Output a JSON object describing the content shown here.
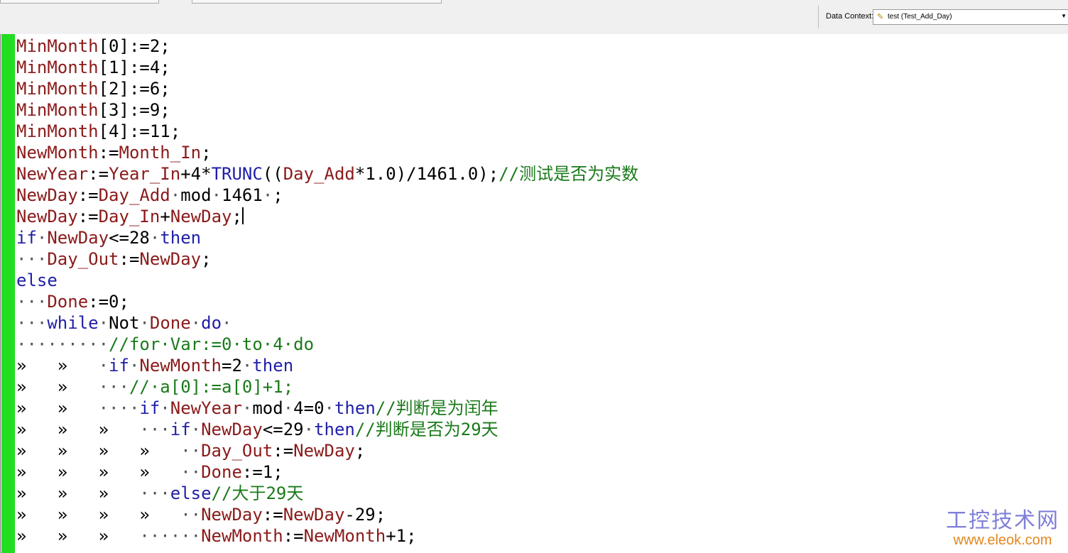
{
  "toolbar": {
    "data_context_label": "Data Context:",
    "data_context_value": "test (Test_Add_Day)",
    "data_context_icon": "pencil-icon"
  },
  "editor": {
    "gutter_color": "#22dd22",
    "lines": [
      [
        {
          "t": "MinMonth",
          "c": "id"
        },
        {
          "t": "[0]:=2;",
          "c": "op"
        }
      ],
      [
        {
          "t": "MinMonth",
          "c": "id"
        },
        {
          "t": "[1]:=4;",
          "c": "op"
        }
      ],
      [
        {
          "t": "MinMonth",
          "c": "id"
        },
        {
          "t": "[2]:=6;",
          "c": "op"
        }
      ],
      [
        {
          "t": "MinMonth",
          "c": "id"
        },
        {
          "t": "[3]:=9;",
          "c": "op"
        }
      ],
      [
        {
          "t": "MinMonth",
          "c": "id"
        },
        {
          "t": "[4]:=11;",
          "c": "op"
        }
      ],
      [
        {
          "t": "NewMonth",
          "c": "id"
        },
        {
          "t": ":=",
          "c": "op"
        },
        {
          "t": "Month_In",
          "c": "id"
        },
        {
          "t": ";",
          "c": "op"
        }
      ],
      [
        {
          "t": "NewYear",
          "c": "id"
        },
        {
          "t": ":=",
          "c": "op"
        },
        {
          "t": "Year_In",
          "c": "id"
        },
        {
          "t": "+4*",
          "c": "op"
        },
        {
          "t": "TRUNC",
          "c": "kw"
        },
        {
          "t": "((",
          "c": "op"
        },
        {
          "t": "Day_Add",
          "c": "id"
        },
        {
          "t": "*1.0)/1461.0);",
          "c": "op"
        },
        {
          "t": "//测试是否为实数",
          "c": "cm"
        }
      ],
      [
        {
          "t": "NewDay",
          "c": "id"
        },
        {
          "t": ":=",
          "c": "op"
        },
        {
          "t": "Day_Add",
          "c": "id"
        },
        {
          "t": "·",
          "c": "ws"
        },
        {
          "t": "mod",
          "c": "op"
        },
        {
          "t": "·",
          "c": "ws"
        },
        {
          "t": "1461",
          "c": "op"
        },
        {
          "t": "·",
          "c": "ws"
        },
        {
          "t": ";",
          "c": "op"
        }
      ],
      [
        {
          "t": "NewDay",
          "c": "id"
        },
        {
          "t": ":=",
          "c": "op"
        },
        {
          "t": "Day_In",
          "c": "id"
        },
        {
          "t": "+",
          "c": "op"
        },
        {
          "t": "NewDay",
          "c": "id"
        },
        {
          "t": ";",
          "c": "op"
        },
        {
          "t": "",
          "c": "cursor"
        }
      ],
      [
        {
          "t": "if",
          "c": "kw"
        },
        {
          "t": "·",
          "c": "ws"
        },
        {
          "t": "NewDay",
          "c": "id"
        },
        {
          "t": "<=28",
          "c": "op"
        },
        {
          "t": "·",
          "c": "ws"
        },
        {
          "t": "then",
          "c": "kw"
        }
      ],
      [
        {
          "t": "···",
          "c": "ws"
        },
        {
          "t": "Day_Out",
          "c": "id"
        },
        {
          "t": ":=",
          "c": "op"
        },
        {
          "t": "NewDay",
          "c": "id"
        },
        {
          "t": ";",
          "c": "op"
        }
      ],
      [
        {
          "t": "else",
          "c": "kw"
        }
      ],
      [
        {
          "t": "···",
          "c": "ws"
        },
        {
          "t": "Done",
          "c": "id"
        },
        {
          "t": ":=0;",
          "c": "op"
        }
      ],
      [
        {
          "t": "···",
          "c": "ws"
        },
        {
          "t": "while",
          "c": "kw"
        },
        {
          "t": "·",
          "c": "ws"
        },
        {
          "t": "Not",
          "c": "op"
        },
        {
          "t": "·",
          "c": "ws"
        },
        {
          "t": "Done",
          "c": "id"
        },
        {
          "t": "·",
          "c": "ws"
        },
        {
          "t": "do",
          "c": "kw"
        },
        {
          "t": "·",
          "c": "ws"
        }
      ],
      [
        {
          "t": "·········",
          "c": "ws"
        },
        {
          "t": "//for·Var:=0·to·4·do",
          "c": "cm"
        }
      ],
      [
        {
          "t": "»   »   ",
          "c": "op"
        },
        {
          "t": "·",
          "c": "ws"
        },
        {
          "t": "if",
          "c": "kw"
        },
        {
          "t": "·",
          "c": "ws"
        },
        {
          "t": "NewMonth",
          "c": "id"
        },
        {
          "t": "=2",
          "c": "op"
        },
        {
          "t": "·",
          "c": "ws"
        },
        {
          "t": "then",
          "c": "kw"
        }
      ],
      [
        {
          "t": "»   »   ",
          "c": "op"
        },
        {
          "t": "···",
          "c": "ws"
        },
        {
          "t": "//·a[0]:=a[0]+1;",
          "c": "cm"
        }
      ],
      [
        {
          "t": "»   »   ",
          "c": "op"
        },
        {
          "t": "····",
          "c": "ws"
        },
        {
          "t": "if",
          "c": "kw"
        },
        {
          "t": "·",
          "c": "ws"
        },
        {
          "t": "NewYear",
          "c": "id"
        },
        {
          "t": "·",
          "c": "ws"
        },
        {
          "t": "mod",
          "c": "op"
        },
        {
          "t": "·",
          "c": "ws"
        },
        {
          "t": "4=0",
          "c": "op"
        },
        {
          "t": "·",
          "c": "ws"
        },
        {
          "t": "then",
          "c": "kw"
        },
        {
          "t": "//判断是为闰年",
          "c": "cm"
        }
      ],
      [
        {
          "t": "»   »   »   ",
          "c": "op"
        },
        {
          "t": "···",
          "c": "ws"
        },
        {
          "t": "if",
          "c": "kw"
        },
        {
          "t": "·",
          "c": "ws"
        },
        {
          "t": "NewDay",
          "c": "id"
        },
        {
          "t": "<=29",
          "c": "op"
        },
        {
          "t": "·",
          "c": "ws"
        },
        {
          "t": "then",
          "c": "kw"
        },
        {
          "t": "//判断是否为29天",
          "c": "cm"
        }
      ],
      [
        {
          "t": "»   »   »   »   ",
          "c": "op"
        },
        {
          "t": "··",
          "c": "ws"
        },
        {
          "t": "Day_Out",
          "c": "id"
        },
        {
          "t": ":=",
          "c": "op"
        },
        {
          "t": "NewDay",
          "c": "id"
        },
        {
          "t": ";",
          "c": "op"
        }
      ],
      [
        {
          "t": "»   »   »   »   ",
          "c": "op"
        },
        {
          "t": "··",
          "c": "ws"
        },
        {
          "t": "Done",
          "c": "id"
        },
        {
          "t": ":=1;",
          "c": "op"
        }
      ],
      [
        {
          "t": "»   »   »   ",
          "c": "op"
        },
        {
          "t": "···",
          "c": "ws"
        },
        {
          "t": "else",
          "c": "kw"
        },
        {
          "t": "//大于29天",
          "c": "cm"
        }
      ],
      [
        {
          "t": "»   »   »   »   ",
          "c": "op"
        },
        {
          "t": "··",
          "c": "ws"
        },
        {
          "t": "NewDay",
          "c": "id"
        },
        {
          "t": ":=",
          "c": "op"
        },
        {
          "t": "NewDay",
          "c": "id"
        },
        {
          "t": "-29;",
          "c": "op"
        }
      ],
      [
        {
          "t": "»   »   »   ",
          "c": "op"
        },
        {
          "t": "······",
          "c": "ws"
        },
        {
          "t": "NewMonth",
          "c": "id"
        },
        {
          "t": ":=",
          "c": "op"
        },
        {
          "t": "NewMonth",
          "c": "id"
        },
        {
          "t": "+1;",
          "c": "op"
        }
      ]
    ]
  },
  "watermark": {
    "cn": "工控技术网",
    "url": "www.eleok.com"
  }
}
